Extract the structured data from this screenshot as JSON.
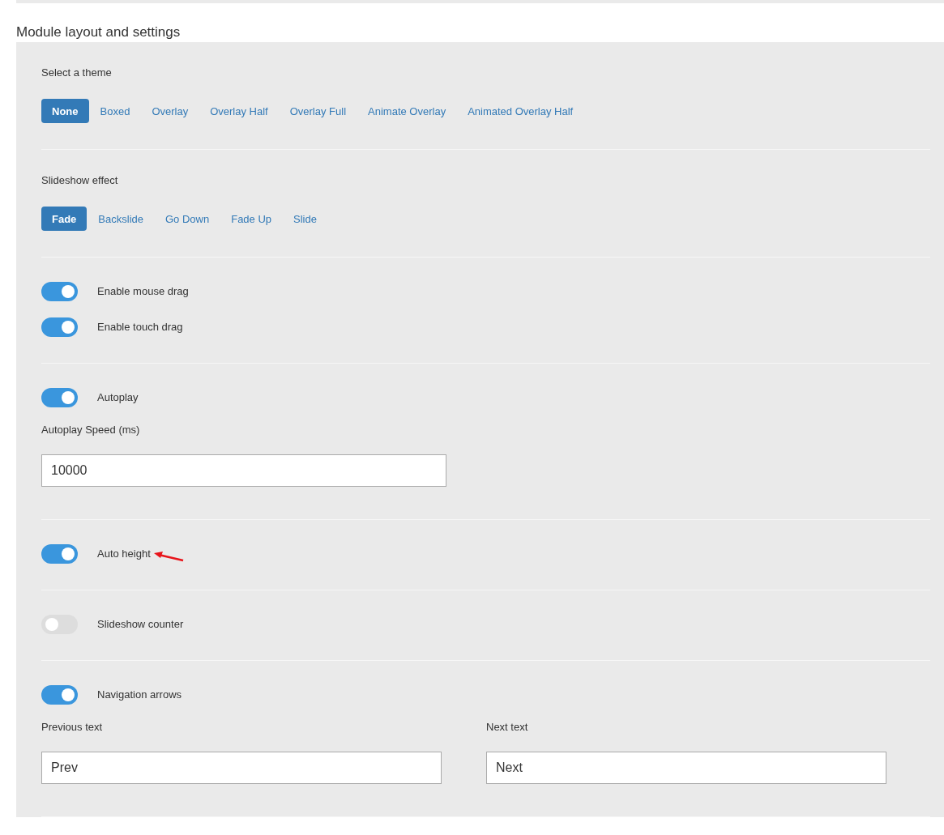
{
  "heading": "Module layout and settings",
  "sections": [
    {
      "items": [
        {
          "kind": "choice",
          "label": "Select a theme",
          "options": [
            {
              "label": "None",
              "selected": true
            },
            {
              "label": "Boxed",
              "selected": false
            },
            {
              "label": "Overlay",
              "selected": false
            },
            {
              "label": "Overlay Half",
              "selected": false
            },
            {
              "label": "Overlay Full",
              "selected": false
            },
            {
              "label": "Animate Overlay",
              "selected": false
            },
            {
              "label": "Animated Overlay Half",
              "selected": false
            }
          ]
        }
      ]
    },
    {
      "items": [
        {
          "kind": "choice",
          "label": "Slideshow effect",
          "options": [
            {
              "label": "Fade",
              "selected": true
            },
            {
              "label": "Backslide",
              "selected": false
            },
            {
              "label": "Go Down",
              "selected": false
            },
            {
              "label": "Fade Up",
              "selected": false
            },
            {
              "label": "Slide",
              "selected": false
            }
          ]
        }
      ]
    },
    {
      "items": [
        {
          "kind": "toggle",
          "label": "Enable mouse drag",
          "on": true
        },
        {
          "kind": "toggle",
          "label": "Enable touch drag",
          "on": true
        }
      ]
    },
    {
      "items": [
        {
          "kind": "toggle",
          "label": "Autoplay",
          "on": true
        },
        {
          "kind": "fields",
          "fields": [
            {
              "label": "Autoplay Speed (ms)",
              "value": "10000"
            }
          ]
        }
      ]
    },
    {
      "items": [
        {
          "kind": "toggle",
          "label": "Auto height",
          "on": true,
          "annotated": true
        }
      ]
    },
    {
      "items": [
        {
          "kind": "toggle",
          "label": "Slideshow counter",
          "on": false
        }
      ]
    },
    {
      "items": [
        {
          "kind": "toggle",
          "label": "Navigation arrows",
          "on": true
        },
        {
          "kind": "fields",
          "fields": [
            {
              "label": "Previous text",
              "value": "Prev"
            },
            {
              "label": "Next text",
              "value": "Next"
            }
          ]
        }
      ]
    }
  ]
}
